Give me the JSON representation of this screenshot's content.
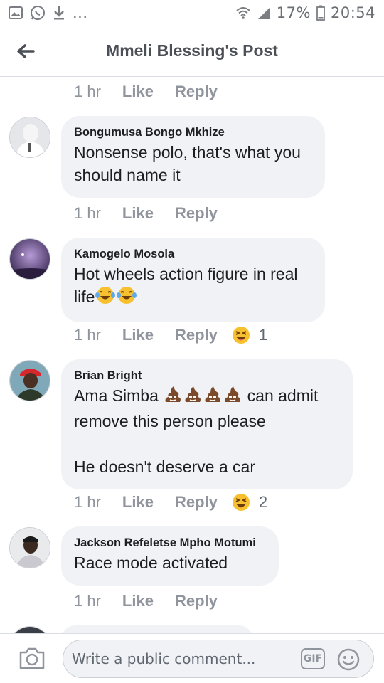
{
  "status_bar": {
    "battery_percent": "17%",
    "time": "20:54",
    "more_label": "..."
  },
  "header": {
    "title": "Mmeli Blessing's Post"
  },
  "top_meta": {
    "time": "1 hr",
    "like_label": "Like",
    "reply_label": "Reply"
  },
  "comments": [
    {
      "author": "Bongumusa Bongo Mkhize",
      "text": "Nonsense polo, that's what you should name it",
      "time": "1 hr",
      "like_label": "Like",
      "reply_label": "Reply"
    },
    {
      "author": "Kamogelo Mosola",
      "text": "Hot wheels action figure in real life",
      "time": "1 hr",
      "like_label": "Like",
      "reply_label": "Reply",
      "reaction": "laughing-emoji",
      "reaction_count": "1"
    },
    {
      "author": "Brian Bright",
      "text_before": "Ama Simba",
      "text_after": "can admit remove this person please\n\nHe doesn't deserve a car",
      "time": "1 hr",
      "like_label": "Like",
      "reply_label": "Reply",
      "reaction": "laughing-emoji",
      "reaction_count": "2"
    },
    {
      "author": "Jackson Refeletse Mpho Motumi",
      "text": "Race mode activated",
      "time": "1 hr",
      "like_label": "Like",
      "reply_label": "Reply"
    }
  ],
  "composer": {
    "placeholder": "Write a public comment...",
    "gif_label": "GIF"
  },
  "colors": {
    "bubble": "#f0f2f5",
    "meta_text": "#90949c",
    "title": "#4b4f56"
  }
}
